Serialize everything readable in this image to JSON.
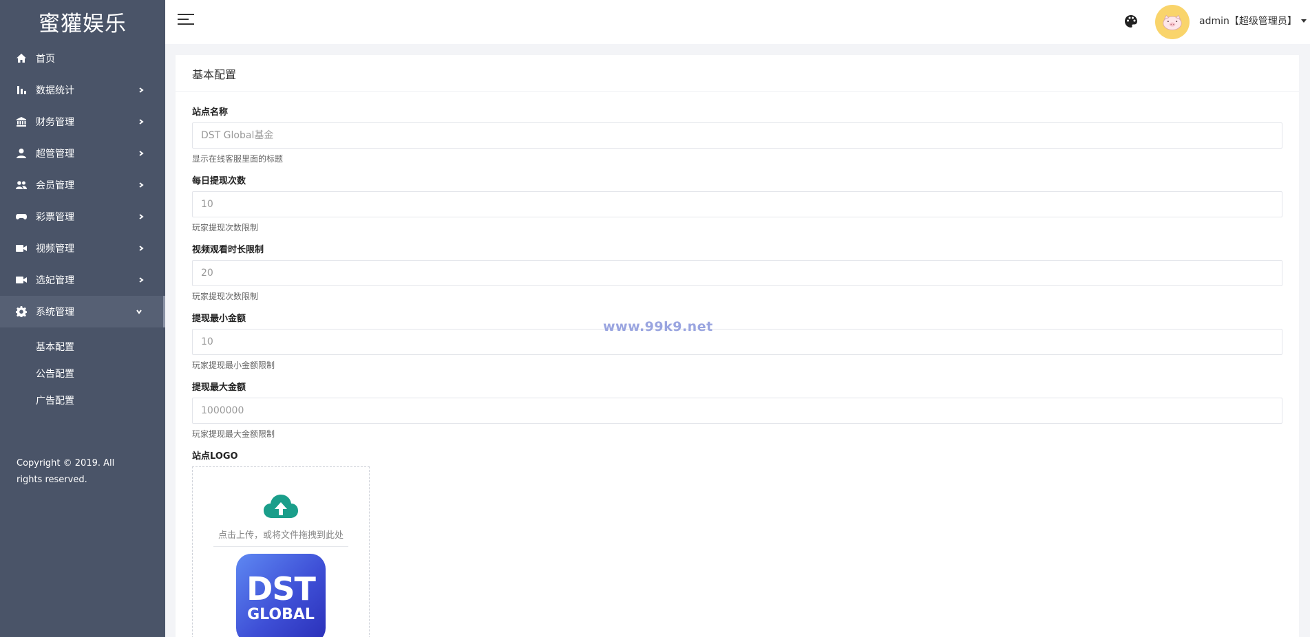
{
  "sidebar": {
    "brand": "蜜獾娱乐",
    "items": [
      {
        "label": "首页",
        "icon": "home-icon"
      },
      {
        "label": "数据统计",
        "icon": "bar-chart-icon"
      },
      {
        "label": "财务管理",
        "icon": "bank-icon"
      },
      {
        "label": "超管管理",
        "icon": "person-icon"
      },
      {
        "label": "会员管理",
        "icon": "people-icon"
      },
      {
        "label": "彩票管理",
        "icon": "gamepad-icon"
      },
      {
        "label": "视频管理",
        "icon": "video-icon"
      },
      {
        "label": "选妃管理",
        "icon": "video-icon"
      },
      {
        "label": "系统管理",
        "icon": "gear-icon"
      }
    ],
    "sub_items": [
      {
        "label": "基本配置"
      },
      {
        "label": "公告配置"
      },
      {
        "label": "广告配置"
      }
    ],
    "copyright": "Copyright © 2019. All rights reserved."
  },
  "header": {
    "username": "admin【超级管理员】",
    "avatar_color": "#f9d46b"
  },
  "card": {
    "title": "基本配置",
    "fields": [
      {
        "label": "站点名称",
        "value": "DST Global基金",
        "help": "显示在线客服里面的标题"
      },
      {
        "label": "每日提现次数",
        "value": "10",
        "help": "玩家提现次数限制"
      },
      {
        "label": "视频观看时长限制",
        "value": "20",
        "help": "玩家提现次数限制"
      },
      {
        "label": "提现最小金额",
        "value": "10",
        "help": "玩家提现最小金额限制"
      },
      {
        "label": "提现最大金额",
        "value": "1000000",
        "help": "玩家提现最大金额限制"
      }
    ],
    "logo_label": "站点LOGO",
    "upload_hint": "点击上传，或将文件拖拽到此处",
    "logo_line1": "DST",
    "logo_line2": "GLOBAL"
  },
  "watermark": "www.99k9.net",
  "colors": {
    "sidebar_bg": "#4a5468",
    "upload_icon": "#1a9e8a",
    "logo_gradient_start": "#5e88f2",
    "logo_gradient_end": "#2a2fb8"
  }
}
